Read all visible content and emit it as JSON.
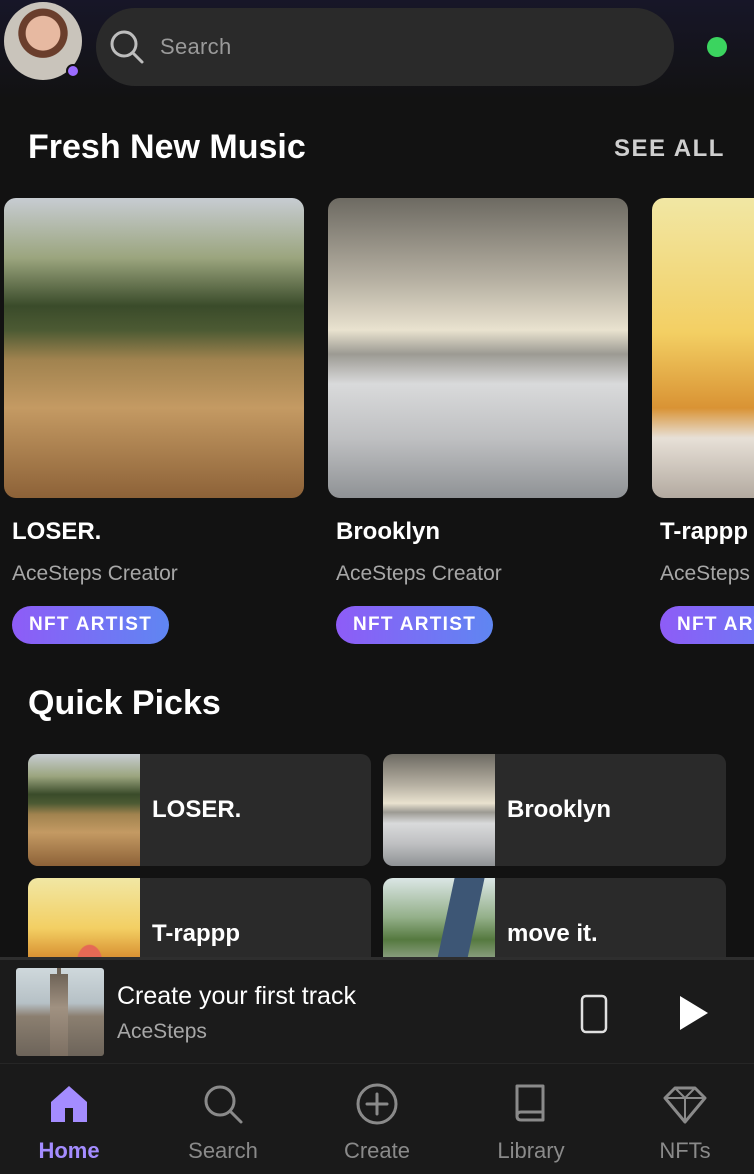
{
  "header": {
    "search_placeholder": "Search"
  },
  "fresh": {
    "title": "Fresh New Music",
    "see_all": "SEE ALL",
    "cards": [
      {
        "title": "LOSER.",
        "subtitle": "AceSteps Creator",
        "badge": "NFT ARTIST"
      },
      {
        "title": "Brooklyn",
        "subtitle": "AceSteps Creator",
        "badge": "NFT ARTIST"
      },
      {
        "title": "T-rappp",
        "subtitle": "AceSteps Creator",
        "badge": "NFT ARTIST"
      }
    ]
  },
  "quick_picks": {
    "title": "Quick Picks",
    "items": [
      {
        "label": "LOSER."
      },
      {
        "label": "Brooklyn"
      },
      {
        "label": "T-rappp"
      },
      {
        "label": "move it."
      }
    ]
  },
  "player": {
    "title": "Create your first track",
    "subtitle": "AceSteps"
  },
  "nav": {
    "items": [
      {
        "label": "Home"
      },
      {
        "label": "Search"
      },
      {
        "label": "Create"
      },
      {
        "label": "Library"
      },
      {
        "label": "NFTs"
      }
    ]
  },
  "colors": {
    "accent": "#a48cff",
    "badge_start": "#8e5cf7",
    "badge_end": "#5f86f2",
    "online": "#3bd45f",
    "background": "#121212"
  },
  "icons": [
    "search-icon",
    "device-icon",
    "play-icon",
    "home-icon",
    "create-icon",
    "library-icon",
    "nfts-icon"
  ]
}
